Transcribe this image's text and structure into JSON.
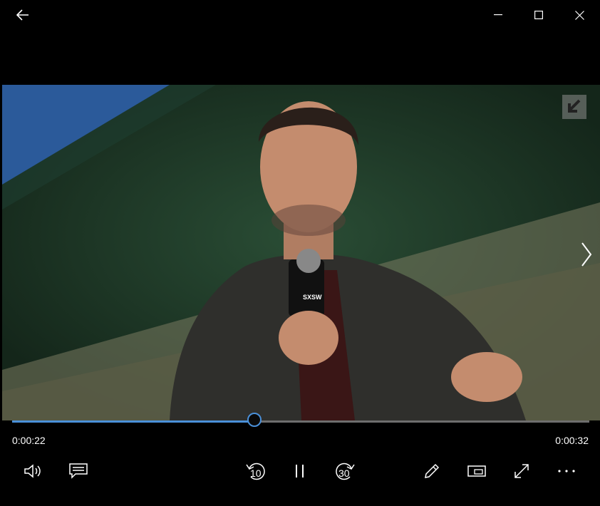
{
  "window": {
    "back_icon": "back-arrow-icon",
    "minimize_icon": "minimize-icon",
    "maximize_icon": "maximize-icon",
    "close_icon": "close-icon"
  },
  "video": {
    "description_icon": "video-frame",
    "mic_logo_text": "SXSW",
    "next_icon": "chevron-right-icon"
  },
  "playback": {
    "elapsed": "0:00:22",
    "remaining": "0:00:32",
    "progress_fraction": 0.42,
    "accent_color": "#4a90d9"
  },
  "controls": {
    "volume_icon": "volume-icon",
    "captions_icon": "captions-icon",
    "skip_back_label": "10",
    "play_pause_icon": "pause-icon",
    "skip_forward_label": "30",
    "edit_icon": "pencil-icon",
    "mini_view_icon": "mini-view-icon",
    "fullscreen_icon": "fullscreen-icon",
    "more_icon": "more-icon"
  }
}
